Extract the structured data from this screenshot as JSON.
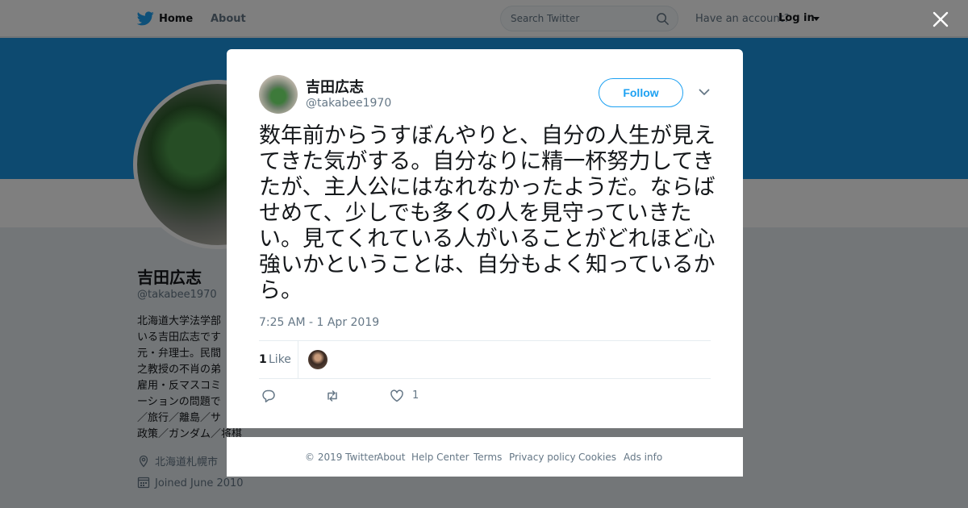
{
  "nav": {
    "home": "Home",
    "about": "About",
    "search_placeholder": "Search Twitter",
    "have_account": "Have an account?",
    "login": "Log in"
  },
  "profile": {
    "name": "吉田広志",
    "handle": "@takabee1970",
    "bio": "北海道大学法学部\nいる吉田広志です\n元・弁理士。民間\n之教授の不肖の弟\n雇用・反マスコミ\nーションの問題で\n／旅行／離島／サ\n政策／ガンダム／将棋…",
    "location": "北海道札幌市",
    "joined": "Joined June 2010"
  },
  "tweet": {
    "name": "吉田広志",
    "handle": "@takabee1970",
    "follow": "Follow",
    "text": "数年前からうすぼんやりと、自分の人生が見えてきた気がする。自分なりに精一杯努力してきたが、主人公にはなれなかったようだ。ならばせめて、少しでも多くの人を見守っていきたい。見てくれている人がいることがどれほど心強いかということは、自分もよく知っているから。",
    "timestamp": "7:25 AM - 1 Apr 2019",
    "likes_count": "1",
    "likes_label": "Like",
    "action_like_count": "1"
  },
  "footer": [
    "© 2019 Twitter",
    "About",
    "Help Center",
    "Terms",
    "Privacy policy",
    "Cookies",
    "Ads info"
  ],
  "colors": {
    "accent": "#1da1f2",
    "banner": "#1b95e0",
    "muted": "#657786"
  }
}
